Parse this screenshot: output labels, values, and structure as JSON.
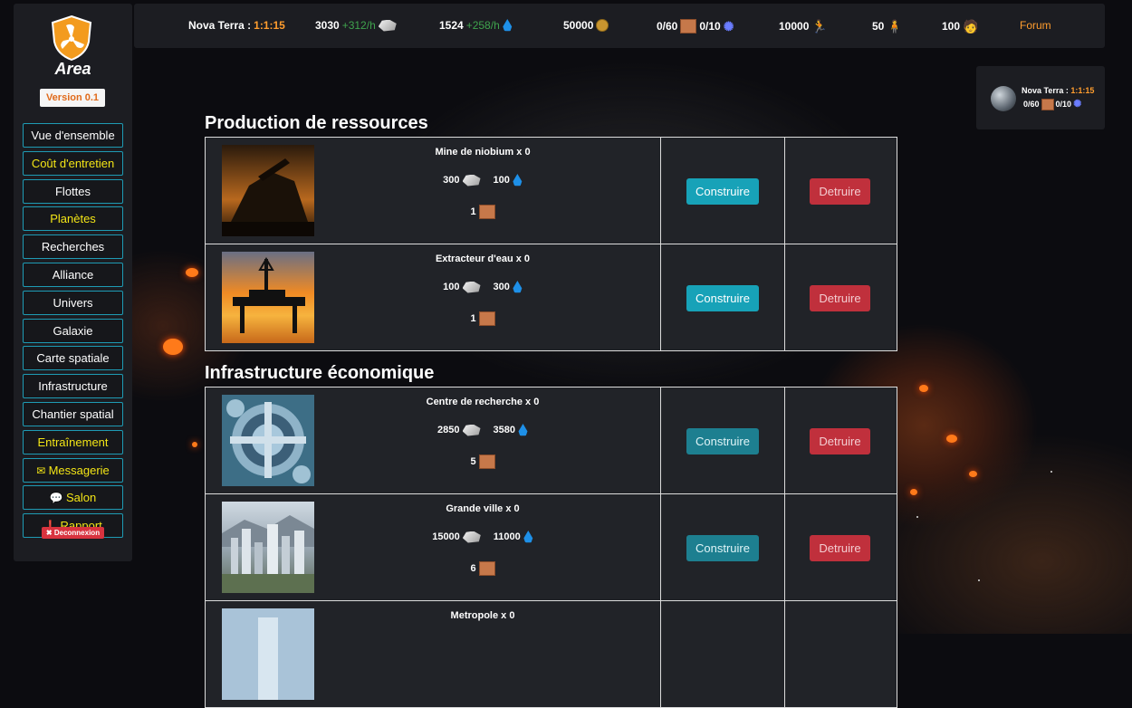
{
  "topbar": {
    "planet_label": "Nova Terra :",
    "planet_coords": "1:1:15",
    "ore_amount": "3030",
    "ore_rate": "+312/h",
    "water_amount": "1524",
    "water_rate": "+258/h",
    "credits": "50000",
    "bricks": "0/60",
    "atoms": "0/10",
    "fuel": "10000",
    "workers": "50",
    "scientists": "100",
    "forum_label": "Forum"
  },
  "sidebar": {
    "logo_text": "Area",
    "version": "Version 0.1",
    "items": [
      {
        "label": "Vue d'ensemble",
        "highlight": false
      },
      {
        "label": "Coût d'entretien",
        "highlight": true
      },
      {
        "label": "Flottes",
        "highlight": false
      },
      {
        "label": "Planètes",
        "highlight": true
      },
      {
        "label": "Recherches",
        "highlight": false
      },
      {
        "label": "Alliance",
        "highlight": false
      },
      {
        "label": "Univers",
        "highlight": false
      },
      {
        "label": "Galaxie",
        "highlight": false
      },
      {
        "label": "Carte spatiale",
        "highlight": false
      },
      {
        "label": "Infrastructure",
        "highlight": false
      },
      {
        "label": "Chantier spatial",
        "highlight": false
      },
      {
        "label": "Entraînement",
        "highlight": true
      },
      {
        "label": "Messagerie",
        "highlight": true,
        "icon": "envelope-icon"
      },
      {
        "label": "Salon",
        "highlight": true,
        "icon": "chat-icon"
      },
      {
        "label": "Rapport",
        "highlight": true,
        "icon": "alert-icon"
      }
    ],
    "logout": "Deconnexion"
  },
  "planet_card": {
    "name": "Nova Terra :",
    "coords": "1:1:15",
    "bricks": "0/60",
    "atoms": "0/10"
  },
  "sections": [
    {
      "title": "Production de ressources",
      "rows": [
        {
          "name": "Mine de niobium x 0",
          "ore": "300",
          "water": "100",
          "bricks": "1",
          "build": "Construire",
          "destroy": "Detruire",
          "build_enabled": true
        },
        {
          "name": "Extracteur d'eau x 0",
          "ore": "100",
          "water": "300",
          "bricks": "1",
          "build": "Construire",
          "destroy": "Detruire",
          "build_enabled": true
        }
      ]
    },
    {
      "title": "Infrastructure économique",
      "rows": [
        {
          "name": "Centre de recherche x 0",
          "ore": "2850",
          "water": "3580",
          "bricks": "5",
          "build": "Construire",
          "destroy": "Detruire",
          "build_enabled": false
        },
        {
          "name": "Grande ville x 0",
          "ore": "15000",
          "water": "11000",
          "bricks": "6",
          "build": "Construire",
          "destroy": "Detruire",
          "build_enabled": false
        },
        {
          "name": "Metropole x 0"
        }
      ]
    }
  ],
  "colors": {
    "accent": "#17a2b8",
    "danger": "#c0303c",
    "highlight": "#f3e516",
    "coords": "#ff9d2e"
  }
}
